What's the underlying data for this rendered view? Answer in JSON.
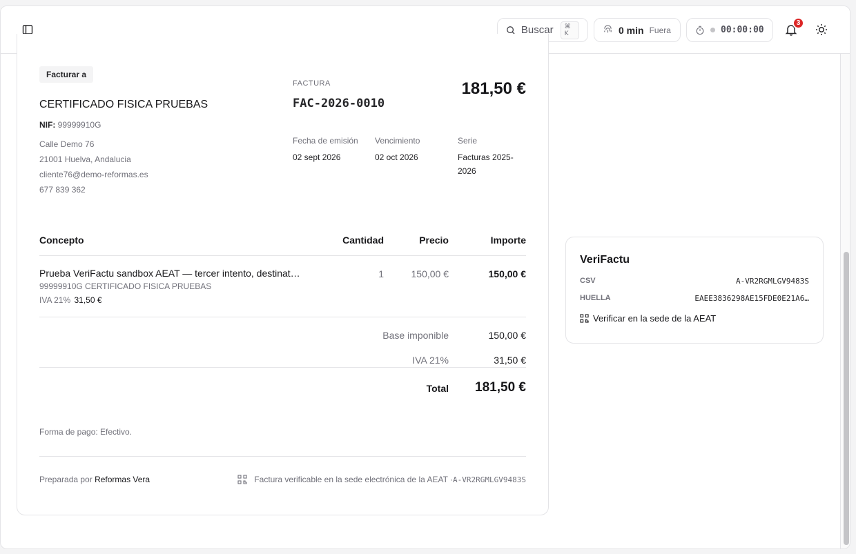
{
  "topbar": {
    "search_label": "Buscar",
    "search_kbd": "⌘ K",
    "presence_time": "0 min",
    "presence_status": "Fuera",
    "timer": "00:00:00",
    "notifications_count": "3"
  },
  "invoice": {
    "bill_to_label": "Facturar a",
    "client_name": "CERTIFICADO FISICA PRUEBAS",
    "nif_label": "NIF:",
    "nif_value": "99999910G",
    "address_line1": "Calle Demo 76",
    "address_line2": "21001 Huelva, Andalucia",
    "email": "cliente76@demo-reformas.es",
    "phone": "677 839 362",
    "doc_type_label": "FACTURA",
    "number": "FAC-2026-0010",
    "total_header": "181,50 €",
    "issue_date_label": "Fecha de emisión",
    "issue_date": "02 sept 2026",
    "due_date_label": "Vencimiento",
    "due_date": "02 oct 2026",
    "series_label": "Serie",
    "series_line1": "Facturas 2025-",
    "series_line2": "2026",
    "table": {
      "headers": {
        "concept": "Concepto",
        "qty": "Cantidad",
        "price": "Precio",
        "amount": "Importe"
      },
      "rows": [
        {
          "concept": "Prueba VeriFactu sandbox AEAT — tercer intento, destinat…",
          "sub": "99999910G CERTIFICADO FISICA PRUEBAS",
          "tax_label": "IVA 21%",
          "tax_value": "31,50 €",
          "qty": "1",
          "price": "150,00 €",
          "amount": "150,00 €"
        }
      ]
    },
    "totals": {
      "base_label": "Base imponible",
      "base_value": "150,00 €",
      "iva_label": "IVA 21%",
      "iva_value": "31,50 €",
      "total_label": "Total",
      "total_value": "181,50 €"
    },
    "payment_note": "Forma de pago: Efectivo.",
    "prepared_by_label": "Preparada por",
    "prepared_by_name": "Reformas Vera",
    "verifiable_note": "Factura verificable en la sede electrónica de la AEAT · ",
    "verifiable_code": "A-VR2RGMLGV9483S"
  },
  "verifactu": {
    "title": "VeriFactu",
    "csv_label": "CSV",
    "csv_value": "A-VR2RGMLGV9483S",
    "huella_label": "HUELLA",
    "huella_value": "EAEE3836298AE15FDE0E21A6…",
    "verify_link": "Verificar en la sede de la AEAT"
  }
}
